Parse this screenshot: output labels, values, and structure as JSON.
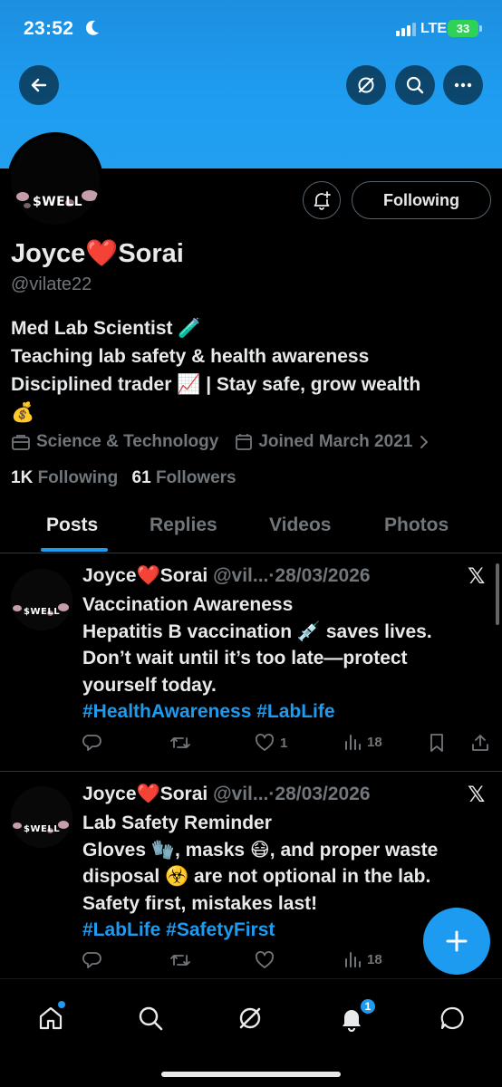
{
  "status_bar": {
    "time": "23:52",
    "network": "LTE",
    "battery": "33"
  },
  "profile": {
    "name": "Joyce❤️Sorai",
    "handle": "@vilate22",
    "avatar_text": "$WELL",
    "bio_lines": [
      "Med Lab Scientist 🧪",
      "Teaching lab safety & health awareness",
      "Disciplined trader 📈 | Stay safe, grow wealth",
      "💰"
    ],
    "category": "Science & Technology",
    "joined": "Joined March 2021",
    "following_count": "1K",
    "following_label": "Following",
    "followers_count": "61",
    "followers_label": "Followers",
    "follow_button": "Following"
  },
  "tabs": [
    "Posts",
    "Replies",
    "Videos",
    "Photos"
  ],
  "active_tab": "Posts",
  "posts": [
    {
      "author": "Joyce❤️Sorai",
      "handle": "@vil...",
      "separator": "·",
      "date": "28/03/2026",
      "lines": [
        "Vaccination Awareness",
        "Hepatitis B vaccination 💉 saves lives.",
        "Don’t wait until it’s too late—protect",
        "yourself today."
      ],
      "hashtags": "#HealthAwareness #LabLife",
      "likes": "1",
      "views": "18"
    },
    {
      "author": "Joyce❤️Sorai",
      "handle": "@vil...",
      "separator": "·",
      "date": "28/03/2026",
      "lines": [
        "Lab Safety Reminder",
        "Gloves 🧤, masks 😷, and proper waste",
        "disposal ☣️ are not optional in the lab.",
        "Safety first, mistakes last!"
      ],
      "hashtags": "#LabLife #SafetyFirst",
      "likes": "",
      "views": "18"
    }
  ],
  "notifications_badge": "1",
  "colors": {
    "accent": "#1d9bf0",
    "banner": "#1e9df1",
    "muted": "#71767b",
    "background": "#000000"
  },
  "icons": [
    "back-arrow-icon",
    "grok-icon",
    "search-icon",
    "more-icon",
    "bell-plus-icon",
    "briefcase-icon",
    "calendar-icon",
    "chevron-right-icon",
    "x-logo-icon",
    "reply-icon",
    "repost-icon",
    "like-icon",
    "views-icon",
    "bookmark-icon",
    "share-icon",
    "plus-icon",
    "home-icon",
    "notifications-icon",
    "messages-icon"
  ]
}
